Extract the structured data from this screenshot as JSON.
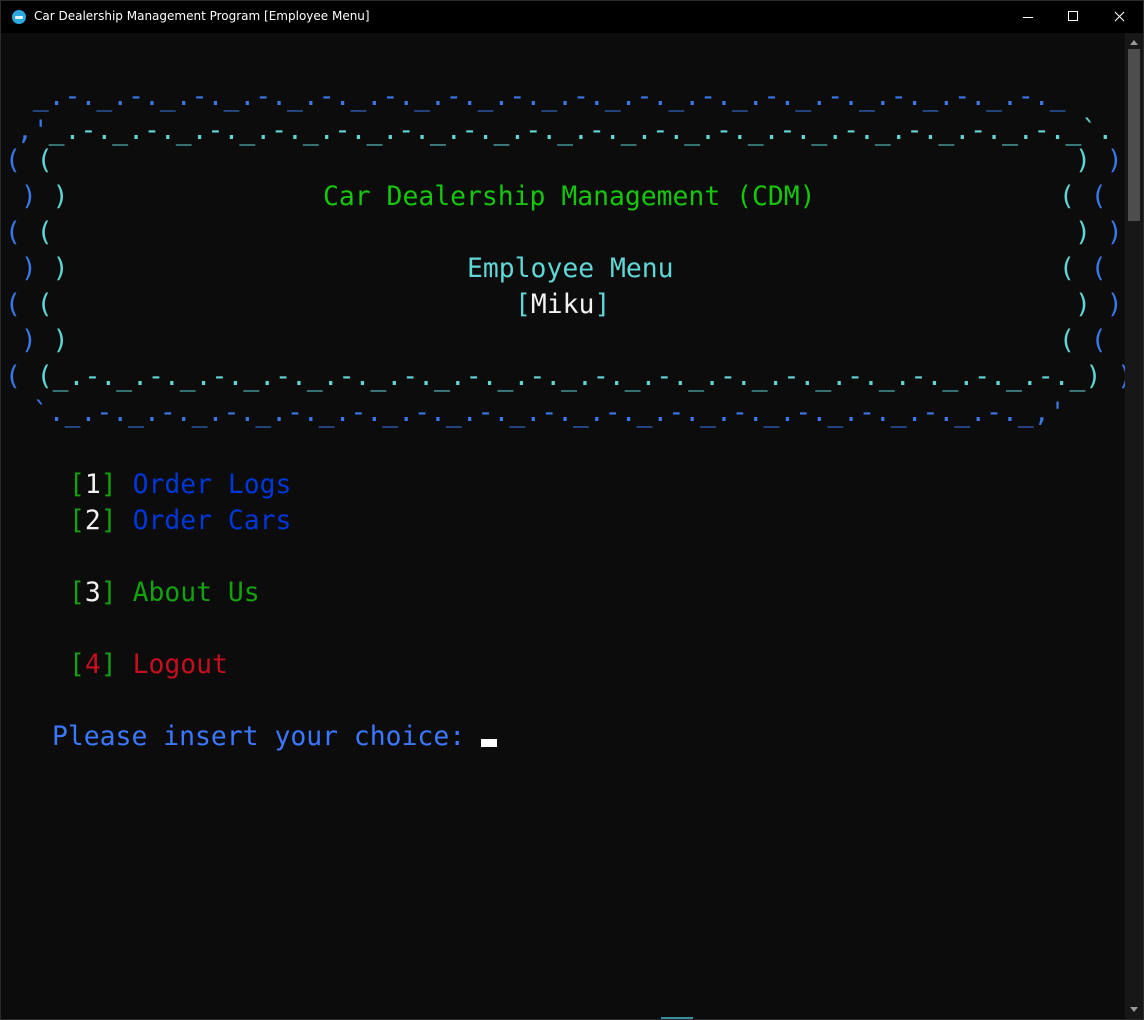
{
  "window": {
    "title": "Car Dealership Management Program [Employee Menu]"
  },
  "banner": {
    "top1": "  _.-._.-._.-._.-._.-._.-._.-._.-._.-._.-._.-._.-._.-._.-._.-._.-._",
    "top2a": " ,'",
    "top2b": "_.-._.-._.-._.-._.-._.-._.-._.-._.-._.-._.-._.-._.-._.-._.-._.-._`.",
    "left_a": "( (",
    "left_b": " ) )",
    "right_a": ") )",
    "right_b": "( (",
    "bottom1_lead": "( (",
    "bottom1_mid": "_.-._.-._.-._.-._.-._.-._.-._.-._.-._.-._.-._.-._.-._.-._.-._.-._",
    "bottom1_tail": ") )",
    "bottom2": "  `._.-._.-._.-._.-._.-._.-._.-._.-._.-._.-._.-._.-._.-._.-._.-._,'",
    "title": "Car Dealership Management (CDM)",
    "subtitle": "Employee Menu",
    "user_open": "[",
    "user": "Miku",
    "user_close": "]"
  },
  "menu": [
    {
      "key": "1",
      "label": "Order Logs"
    },
    {
      "key": "2",
      "label": "Order Cars"
    },
    {
      "key": "3",
      "label": "About Us"
    },
    {
      "key": "4",
      "label": "Logout"
    }
  ],
  "bracket_open": "[",
  "bracket_close": "]",
  "prompt": "Please insert your choice:"
}
